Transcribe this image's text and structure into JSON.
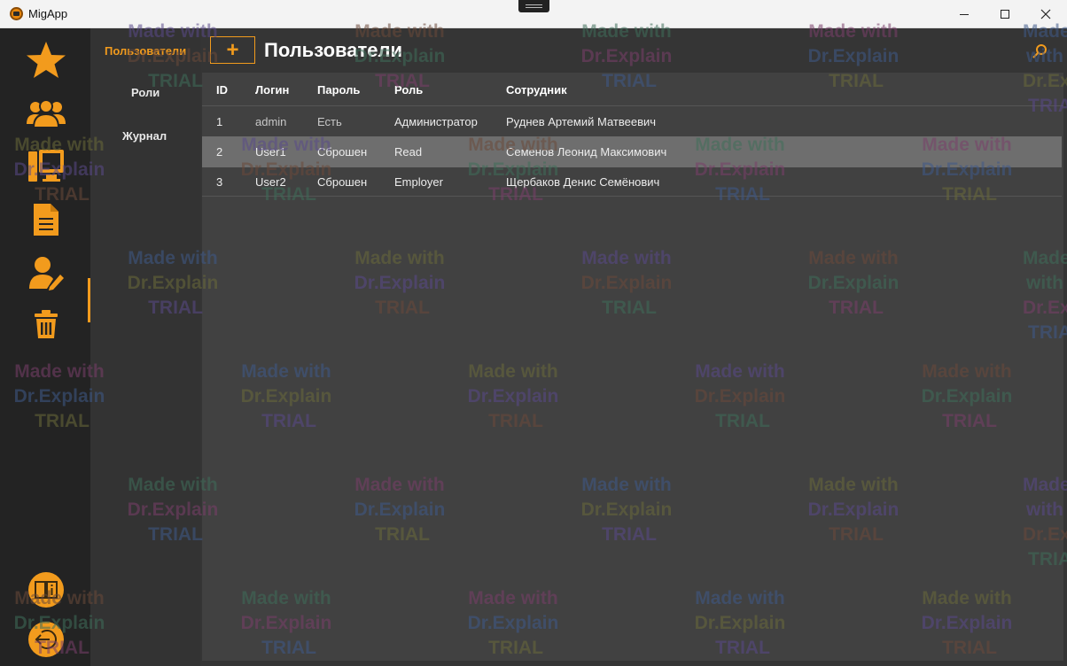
{
  "window": {
    "title": "MigApp"
  },
  "subnav": {
    "items": [
      {
        "label": "Пользователи",
        "active": true
      },
      {
        "label": "Роли",
        "active": false
      },
      {
        "label": "Журнал",
        "active": false
      }
    ]
  },
  "main": {
    "title": "Пользователи",
    "add_label": "+"
  },
  "table": {
    "columns": [
      "ID",
      "Логин",
      "Пароль",
      "Роль",
      "Сотрудник"
    ],
    "rows": [
      [
        "1",
        "admin",
        "Есть",
        "Администратор",
        "Руднев Артемий Матвеевич"
      ],
      [
        "2",
        "User1",
        "Сброшен",
        "Read",
        "Семенов Леонид Максимович"
      ],
      [
        "3",
        "User2",
        "Сброшен",
        "Employer",
        "Щербаков Денис Семёнович"
      ]
    ],
    "selected_row": 1
  },
  "watermark": {
    "line1": "Made with",
    "line2": "Dr.Explain",
    "line3": "TRIAL"
  },
  "colors": {
    "accent": "#f29b1d",
    "sidebar": "#232323",
    "subnav": "#333333",
    "grid": "#414141",
    "selected_row": "#6e6e6e"
  },
  "icons": {
    "nav": [
      "star-icon",
      "users-group-icon",
      "computer-icon",
      "document-icon",
      "user-edit-icon",
      "trash-icon"
    ],
    "bottom": [
      "help-book-icon",
      "logout-icon"
    ],
    "search": "search-icon"
  }
}
